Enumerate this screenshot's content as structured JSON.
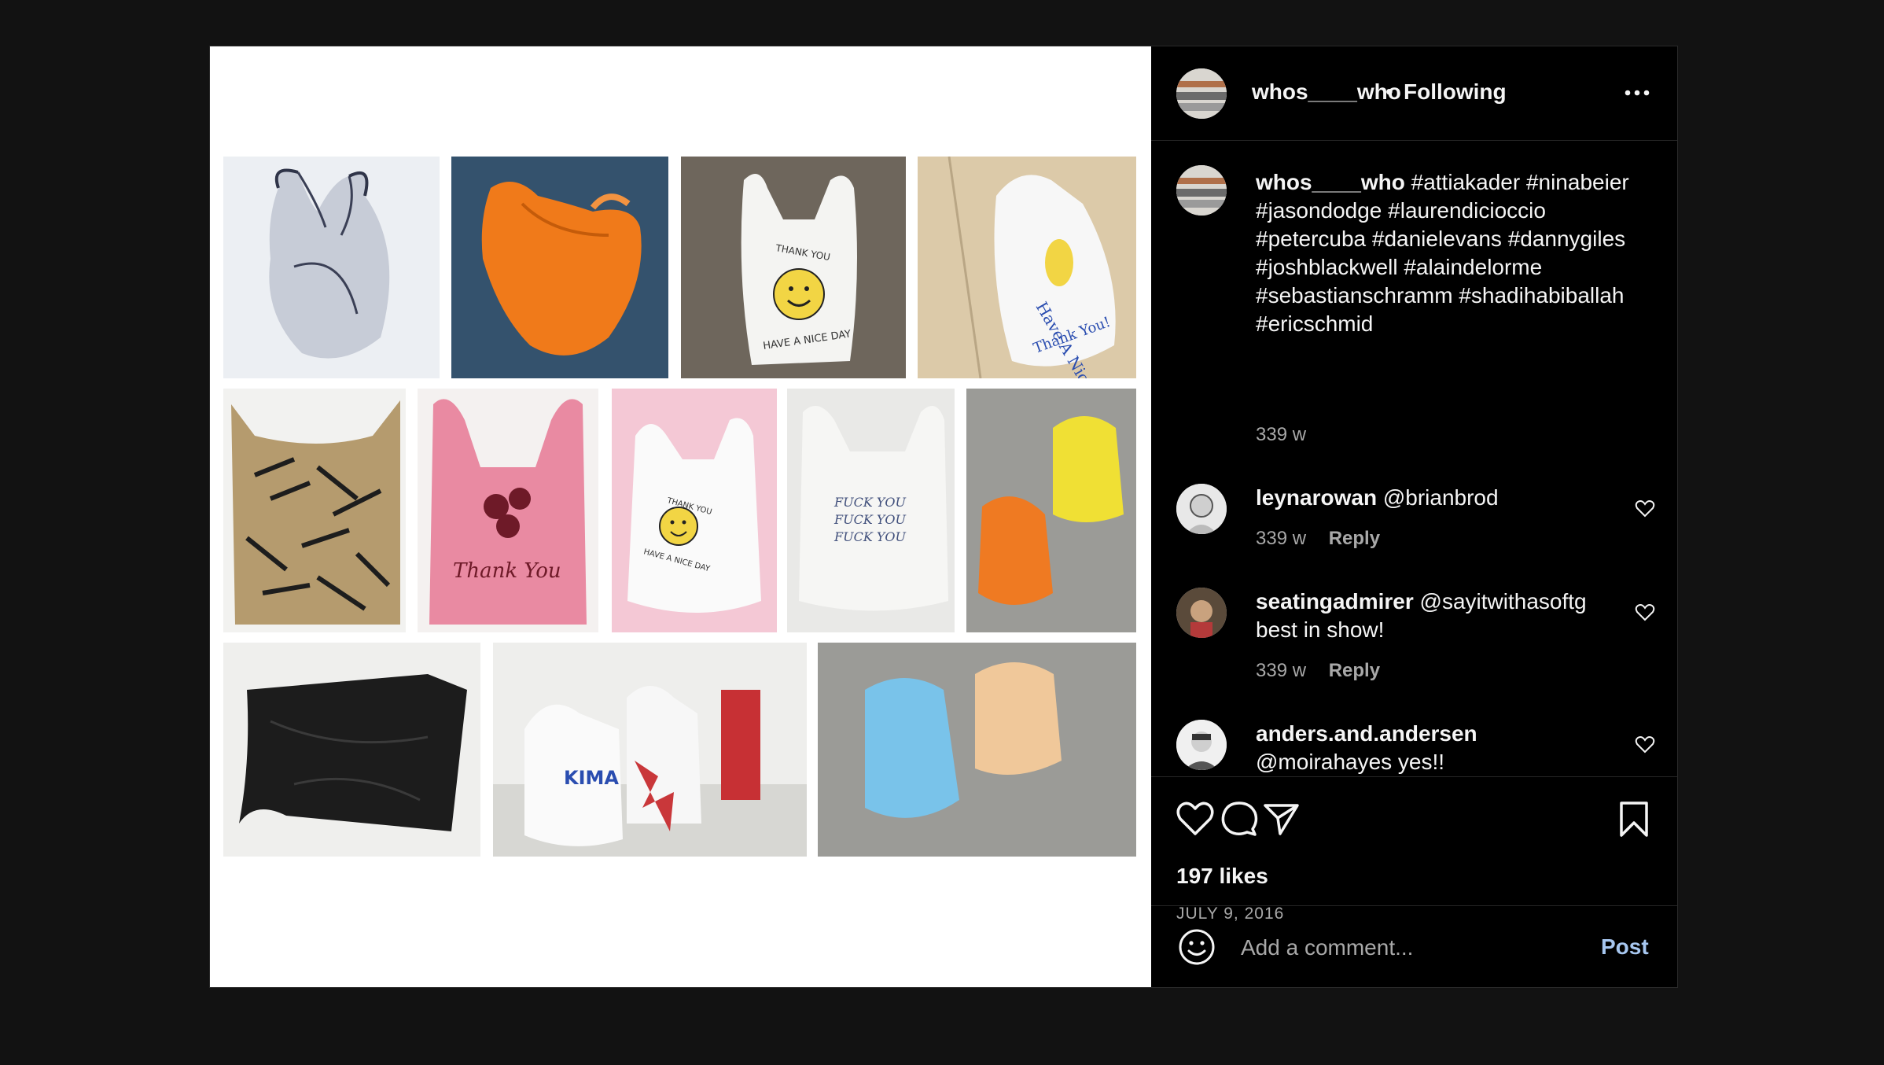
{
  "post": {
    "username": "whos____who",
    "separator": "•",
    "follow_status": "Following",
    "more_icon": "more-horizontal-icon"
  },
  "caption": {
    "username": "whos____who",
    "text": "#attiakader #ninabeier #jasondodge #laurendicioccio #petercuba #danielevans #dannygiles #joshblackwell #alaindelorme #sebastianschramm #shadihabiballah #ericschmid",
    "time": "339 w"
  },
  "comments": [
    {
      "username": "leynarowan",
      "text": "@brianbrod",
      "time": "339 w",
      "reply": "Reply"
    },
    {
      "username": "seatingadmirer",
      "text": "@sayitwithasoftg best in show!",
      "time": "339 w",
      "reply": "Reply"
    },
    {
      "username": "anders.and.andersen",
      "text": "@moirahayes yes!!",
      "time": "",
      "reply": ""
    }
  ],
  "actions": {
    "like_icon": "heart-icon",
    "comment_icon": "comment-bubble-icon",
    "share_icon": "paper-plane-icon",
    "save_icon": "bookmark-icon"
  },
  "likes": "197 likes",
  "date": "JULY 9, 2016",
  "add_comment": {
    "placeholder": "Add a comment...",
    "post_label": "Post"
  },
  "media_tiles": [
    {
      "subject": "grey mesh bag"
    },
    {
      "subject": "orange bag on blue"
    },
    {
      "subject": "smiley thank you bag"
    },
    {
      "subject": "have a nice day bag on sand"
    },
    {
      "subject": "taped brown bag"
    },
    {
      "subject": "pink thank you bag"
    },
    {
      "subject": "thank you smiley bag on pink"
    },
    {
      "subject": "white text bag"
    },
    {
      "subject": "yellow and orange bags"
    },
    {
      "subject": "black bag"
    },
    {
      "subject": "white printed bags"
    },
    {
      "subject": "blue and peach bags"
    }
  ],
  "colors": {
    "background": "#121212",
    "panel": "#000000",
    "text": "#f5f5f5",
    "muted": "#a8a8a8",
    "post_button": "#a7c7f0"
  }
}
